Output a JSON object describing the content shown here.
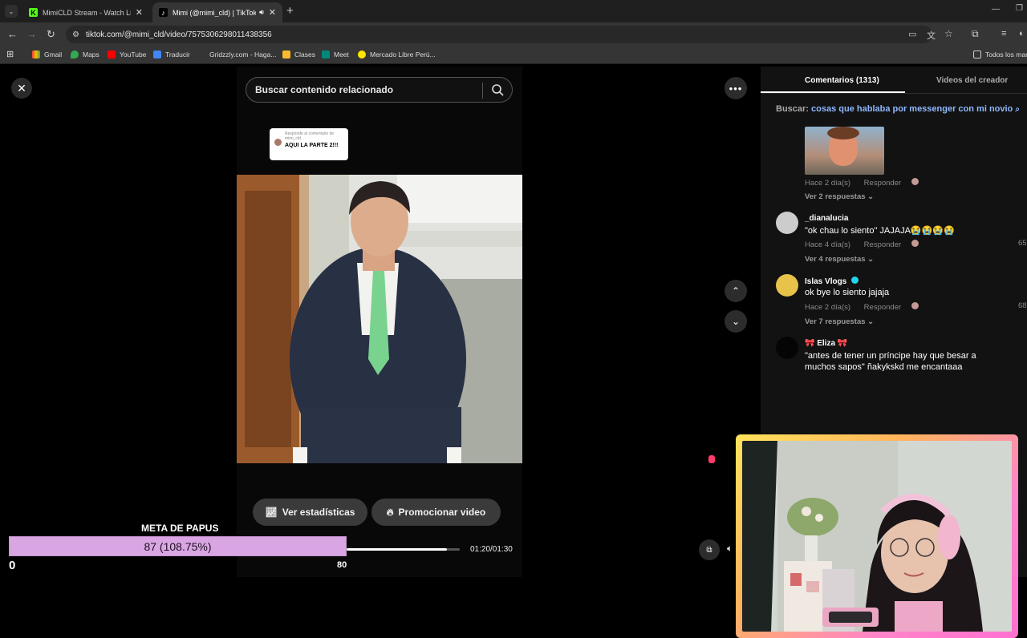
{
  "browser": {
    "tabs": [
      {
        "title": "MimiCLD Stream - Watch Live o",
        "favicon": "kick-icon",
        "active": false
      },
      {
        "title": "Mimi (@mimi_cld) | TikTok",
        "favicon": "tiktok-icon",
        "active": true
      }
    ],
    "url": "tiktok.com/@mimi_cld/video/7575306298011438356",
    "bookmarks": [
      "Gmail",
      "Maps",
      "YouTube",
      "Traducir",
      "Gridzzly.com - Haga...",
      "Clases",
      "Meet",
      "Mercado Libre Perú..."
    ],
    "all_bookmarks": "Todos los mar"
  },
  "video": {
    "search_placeholder": "Buscar contenido relacionado",
    "reply_card": {
      "header": "Responde al comentario de mimi_cld",
      "text": "AQUI LA PARTE 2!!!"
    },
    "stats_button": "Ver estadísticas",
    "promote_button": "Promocionar video",
    "time": "01:20/01:30",
    "progress": 0.89
  },
  "comments": {
    "tab_comments": "Comentarios (1313)",
    "tab_creator": "Videos del creador",
    "search_prefix": "Buscar:",
    "search_term": "cosas que hablaba por messenger con mi novio",
    "items": [
      {
        "meta": "Hace 2 día(s)",
        "reply": "Responder",
        "more": "Ver 2 respuestas"
      },
      {
        "name": "_dianalucia",
        "text": "\"ok chau lo siento\" JAJAJA😭😭😭😭",
        "meta": "Hace 4 día(s)",
        "reply": "Responder",
        "more": "Ver 4 respuestas",
        "likes": "65"
      },
      {
        "name": "Islas Vlogs",
        "text": "ok bye lo siento jajaja",
        "meta": "Hace 2 día(s)",
        "reply": "Responder",
        "more": "Ver 7 respuestas",
        "likes": "68"
      },
      {
        "name": "🎀 Eliza 🎀",
        "text": "\"antes de tener un príncipe hay que besar a muchos sapos\" ñakykskd me encantaaa"
      }
    ]
  },
  "overlay": {
    "goal_title": "META DE PAPUS",
    "goal_value": "87 (108.75%)",
    "goal_min": "0",
    "goal_max": "80",
    "goal_progress": 1.0875
  },
  "colors": {
    "goal_fill": "#d9a6e3",
    "link": "#8fb8ff",
    "verified": "#20d5ec"
  }
}
